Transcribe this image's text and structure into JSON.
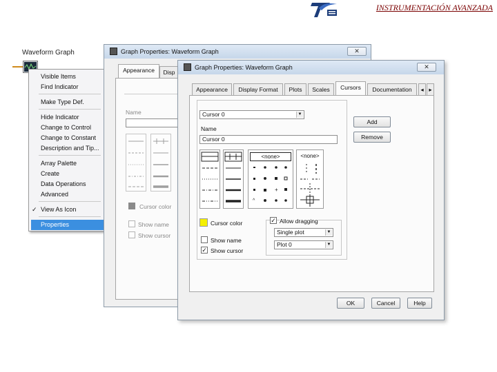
{
  "header": {
    "title": "INSTRUMENTACIÓN AVANZADA"
  },
  "context_menu": {
    "control_label": "Waveform Graph",
    "items": [
      "Visible Items",
      "Find Indicator",
      "Make Type Def.",
      "Hide Indicator",
      "Change to Control",
      "Change to Constant",
      "Description and Tip...",
      "Array Palette",
      "Create",
      "Data Operations",
      "Advanced",
      "View As Icon",
      "Properties"
    ],
    "checked_item": "View As Icon",
    "selected_item": "Properties"
  },
  "back_dialog": {
    "title": "Graph Properties: Waveform Graph",
    "tabs": [
      "Appearance",
      "Disp"
    ],
    "name_label": "Name",
    "cursor_color_label": "Cursor color",
    "show_name_label": "Show name",
    "show_cursor_label": "Show cursor",
    "close_glyph": "✕"
  },
  "front_dialog": {
    "title": "Graph Properties: Waveform Graph",
    "close_glyph": "✕",
    "tabs": [
      "Appearance",
      "Display Format",
      "Plots",
      "Scales",
      "Cursors",
      "Documentation"
    ],
    "active_tab": "Cursors",
    "tab_scroll_left": "◂",
    "tab_scroll_right": "▸",
    "cursor_select": "Cursor 0",
    "name_label": "Name",
    "name_value": "Cursor 0",
    "add_button": "Add",
    "remove_button": "Remove",
    "none_label_1": "<none>",
    "none_label_2": "<none>",
    "cursor_color_label": "Cursor color",
    "cursor_color": "#f5f000",
    "show_name_label": "Show name",
    "show_name_checked": false,
    "show_cursor_label": "Show cursor",
    "show_cursor_checked": true,
    "allow_dragging_label": "Allow dragging",
    "allow_dragging_checked": true,
    "drag_mode_value": "Single plot",
    "plot_value": "Plot 0",
    "ok_button": "OK",
    "cancel_button": "Cancel",
    "help_button": "Help"
  },
  "colors": {
    "menu_highlight": "#3b8fe0",
    "header_text": "#7a0000",
    "title_bar": "#c6d7ea"
  }
}
